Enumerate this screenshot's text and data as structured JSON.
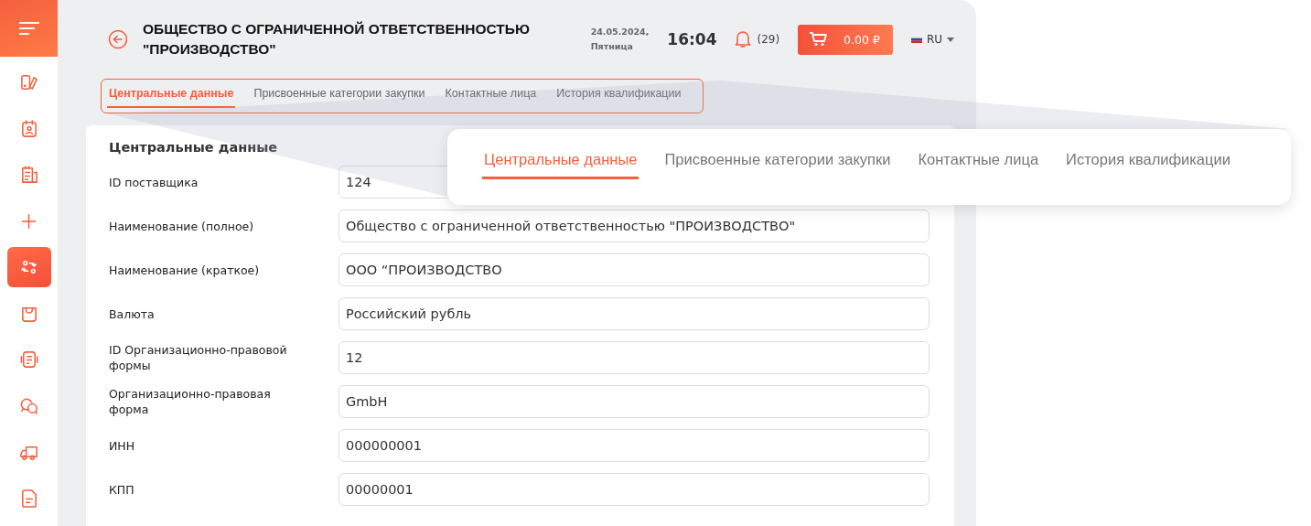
{
  "sidebar": {
    "items": [
      {
        "selected": false
      },
      {
        "selected": false
      },
      {
        "selected": false
      },
      {
        "selected": false
      },
      {
        "selected": true
      },
      {
        "selected": false
      },
      {
        "selected": false
      },
      {
        "selected": false
      },
      {
        "selected": false
      },
      {
        "selected": false
      }
    ]
  },
  "header": {
    "title": "ОБЩЕСТВО С ОГРАНИЧЕННОЙ ОТВЕТСТВЕННОСТЬЮ \"ПРОИЗВОДСТВО\"",
    "date": "24.05.2024,",
    "weekday": "Пятница",
    "time": "16:04",
    "notifications": "(29)",
    "cart_total": "0.00 ₽",
    "language": "RU"
  },
  "tabs": [
    {
      "label": "Центральные данные",
      "selected": true
    },
    {
      "label": "Присвоенные категории закупки",
      "selected": false
    },
    {
      "label": "Контактные лица",
      "selected": false
    },
    {
      "label": "История квалификации",
      "selected": false
    }
  ],
  "form": {
    "title": "Центральные данные",
    "fields": [
      {
        "label": "ID поставщика",
        "value": "124"
      },
      {
        "label": "Наименование (полное)",
        "value": "Общество с ограниченной ответственностью \"ПРОИЗВОДСТВО\""
      },
      {
        "label": "Наименование (краткое)",
        "value": "ООО “ПРОИЗВОДСТВО"
      },
      {
        "label": "Валюта",
        "value": "Российский рубль"
      },
      {
        "label": "ID Организационно-правовой формы",
        "value": "12"
      },
      {
        "label": "Организационно-правовая форма",
        "value": "GmbH"
      },
      {
        "label": "ИНН",
        "value": "000000001"
      },
      {
        "label": "КПП",
        "value": "00000001"
      }
    ]
  },
  "callout": {
    "tabs": [
      {
        "label": "Центральные данные",
        "selected": true
      },
      {
        "label": "Присвоенные категории закупки",
        "selected": false
      },
      {
        "label": "Контактные лица",
        "selected": false
      },
      {
        "label": "История квалификации",
        "selected": false
      }
    ]
  }
}
